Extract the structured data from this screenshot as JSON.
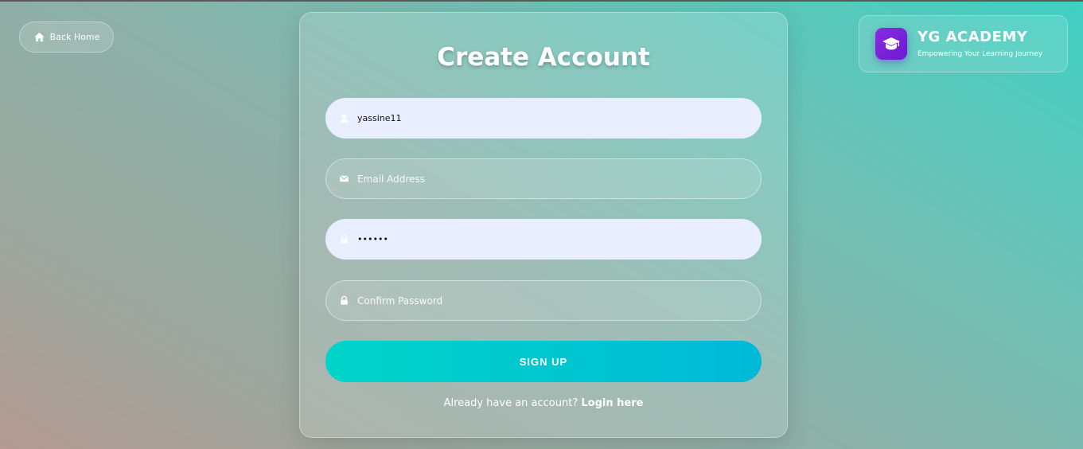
{
  "nav": {
    "back_home_label": "Back Home",
    "back_home_icon": "home-icon"
  },
  "brand": {
    "title": "YG ACADEMY",
    "subtitle": "Empowering Your Learning Journey",
    "logo_icon": "graduation-cap-icon",
    "logo_color": "#7c22e6"
  },
  "form": {
    "title": "Create Account",
    "username": {
      "value": "yassine11",
      "icon": "user-icon"
    },
    "email": {
      "value": "",
      "placeholder": "Email Address",
      "icon": "envelope-icon"
    },
    "password": {
      "value": "••••••",
      "icon": "lock-icon"
    },
    "confirm_password": {
      "value": "",
      "placeholder": "Confirm Password",
      "icon": "lock-icon"
    },
    "submit_label": "SIGN UP",
    "login_prompt": "Already have an account?",
    "login_link": "Login here"
  },
  "colors": {
    "accent_start": "#00d4c8",
    "accent_end": "#00b8d8",
    "filled_field_bg": "#e8eefe"
  }
}
